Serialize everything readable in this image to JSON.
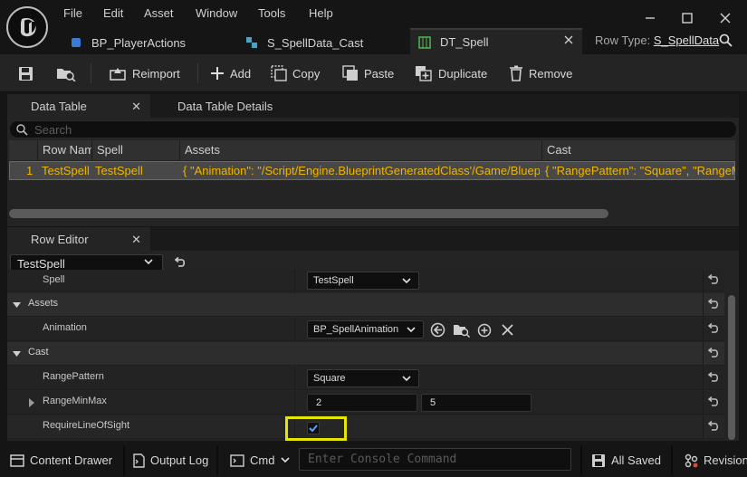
{
  "menu": [
    "File",
    "Edit",
    "Asset",
    "Window",
    "Tools",
    "Help"
  ],
  "tabs": [
    {
      "label": "BP_PlayerActions"
    },
    {
      "label": "S_SpellData_Cast"
    },
    {
      "label": "DT_Spell"
    }
  ],
  "row_type": {
    "label": "Row Type:",
    "value": "S_SpellData"
  },
  "toolbar": {
    "reimport": "Reimport",
    "add": "Add",
    "copy": "Copy",
    "paste": "Paste",
    "duplicate": "Duplicate",
    "remove": "Remove"
  },
  "data_table_panel": {
    "tab_active": "Data Table",
    "tab_inactive": "Data Table Details",
    "search_placeholder": "Search",
    "columns": [
      "Row Nam",
      "Spell",
      "Assets",
      "Cast"
    ],
    "row": {
      "index": "1",
      "name": "TestSpell",
      "spell": "TestSpell",
      "assets": "{ \"Animation\": \"/Script/Engine.BlueprintGeneratedClass'/Game/Blueprints",
      "cast": "{ \"RangePattern\": \"Square\", \"RangeMinMa"
    }
  },
  "row_editor": {
    "tab": "Row Editor",
    "selected_row": "TestSpell",
    "properties": {
      "spell": {
        "name": "Spell",
        "value": "TestSpell"
      },
      "assets_cat": "Assets",
      "animation": {
        "name": "Animation",
        "value": "BP_SpellAnimation"
      },
      "cast_cat": "Cast",
      "range_pattern": {
        "name": "RangePattern",
        "value": "Square"
      },
      "range_min_max": {
        "name": "RangeMinMax",
        "min": "2",
        "max": "5"
      },
      "require_los": {
        "name": "RequireLineOfSight",
        "checked": true
      }
    }
  },
  "status_bar": {
    "content_drawer": "Content Drawer",
    "output_log": "Output Log",
    "cmd": "Cmd",
    "console_placeholder": "Enter Console Command",
    "saved": "All Saved",
    "revision": "Revision"
  },
  "colors": {
    "accent_green": "#4fb84f",
    "highlight_yellow": "#f0b400",
    "focus_outline": "#e6e600"
  }
}
